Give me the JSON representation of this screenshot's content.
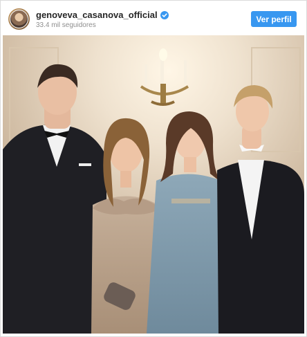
{
  "post": {
    "username": "genoveva_casanova_official",
    "followers": "33.4 mil seguidores",
    "profile_button_label": "Ver perfil",
    "verified": true
  },
  "icons": {
    "avatar": "profile-avatar",
    "verified": "verified-badge-icon"
  },
  "photo": {
    "subject": "family portrait in formal evening wear"
  },
  "colors": {
    "button_bg": "#3897f0",
    "username": "#262626",
    "secondary_text": "#8e8e8e",
    "verified_badge": "#3897f0"
  }
}
